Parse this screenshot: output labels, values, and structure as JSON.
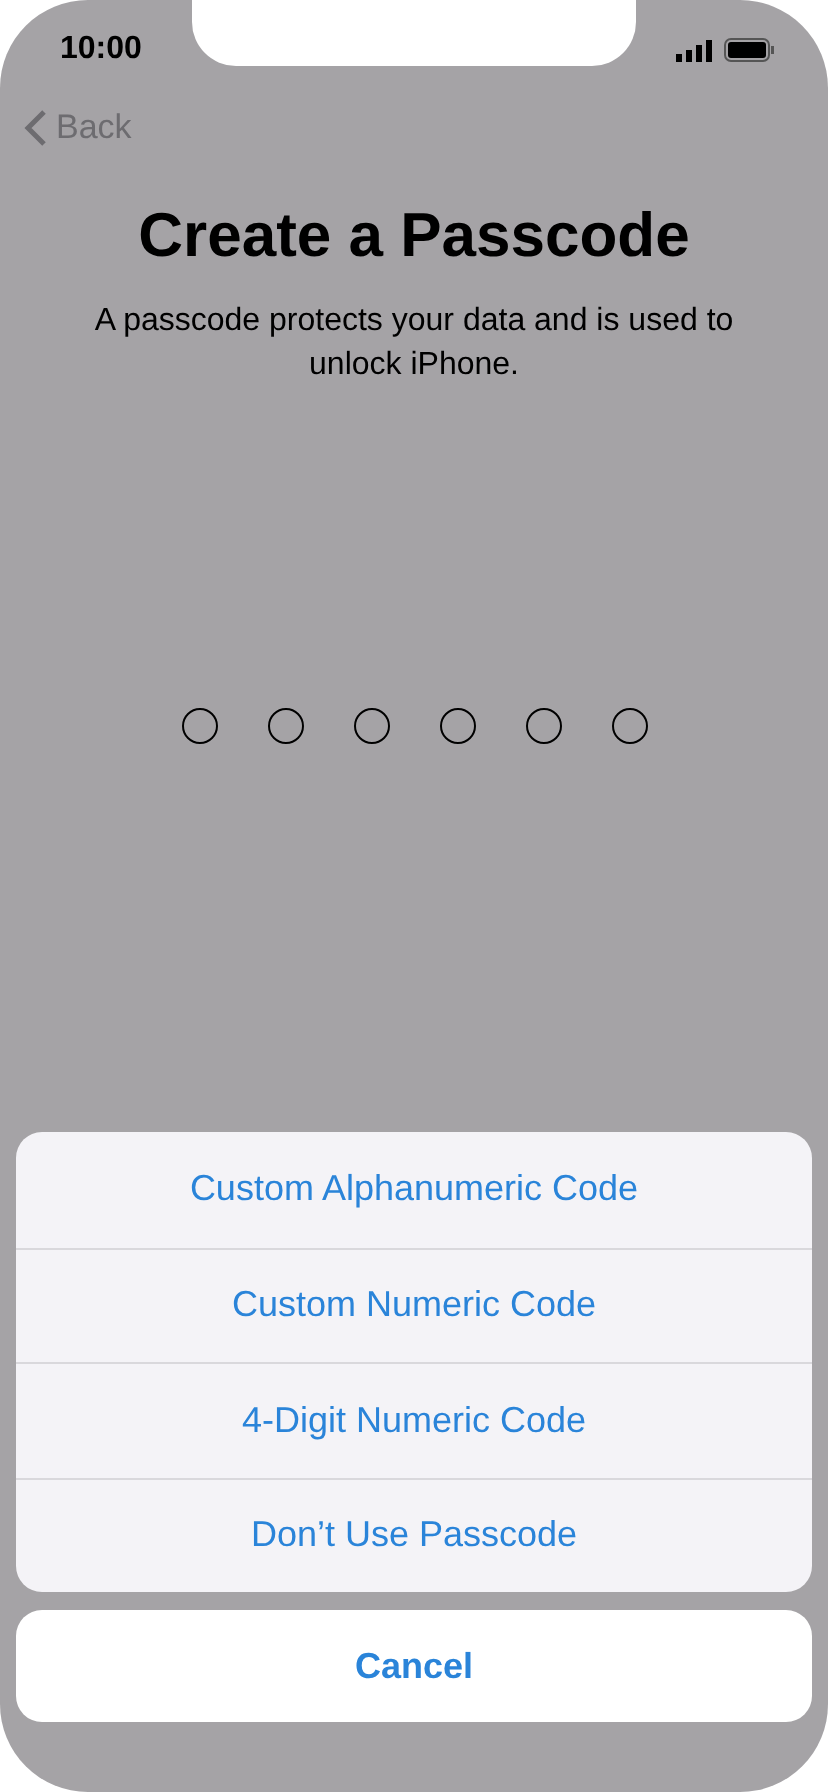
{
  "status_bar": {
    "time": "10:00"
  },
  "nav": {
    "back": "Back"
  },
  "title": "Create a Passcode",
  "subtitle": "A passcode protects your data and is used to unlock iPhone.",
  "passcode_dots": [
    {
      "filled": false
    },
    {
      "filled": false
    },
    {
      "filled": false
    },
    {
      "filled": false
    },
    {
      "filled": false
    },
    {
      "filled": false
    }
  ],
  "action_sheet": {
    "options": [
      "Custom Alphanumeric Code",
      "Custom Numeric Code",
      "4-Digit Numeric Code",
      "Don’t Use Passcode"
    ],
    "cancel": "Cancel"
  }
}
